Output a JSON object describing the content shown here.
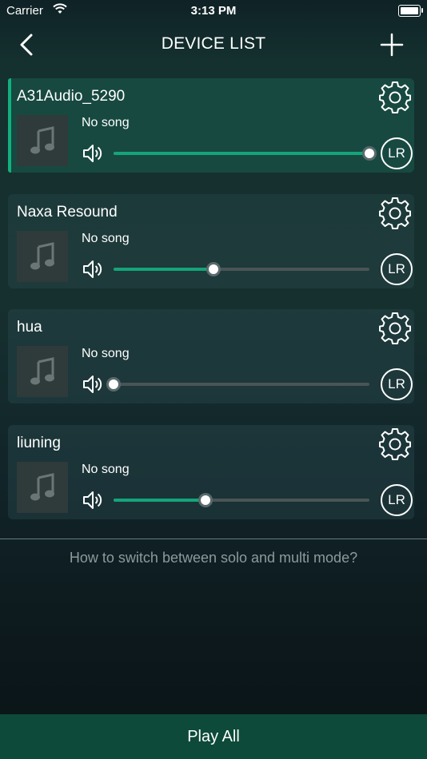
{
  "status_bar": {
    "carrier": "Carrier",
    "time": "3:13 PM"
  },
  "nav": {
    "title": "DEVICE LIST",
    "back_icon": "chevron-left-icon",
    "add_icon": "plus-icon"
  },
  "devices": [
    {
      "name": "A31Audio_5290",
      "song": "No song",
      "volume": 1.0,
      "channel": "LR",
      "active": true
    },
    {
      "name": "Naxa Resound",
      "song": "No song",
      "volume": 0.39,
      "channel": "LR",
      "active": false
    },
    {
      "name": "hua",
      "song": "No song",
      "volume": 0.0,
      "channel": "LR",
      "active": false
    },
    {
      "name": "liuning",
      "song": "No song",
      "volume": 0.36,
      "channel": "LR",
      "active": false
    }
  ],
  "hint": "How to switch between solo and multi mode?",
  "play_all_label": "Play All",
  "colors": {
    "accent": "#12b07f",
    "play_all_bg": "#0d4a39"
  }
}
